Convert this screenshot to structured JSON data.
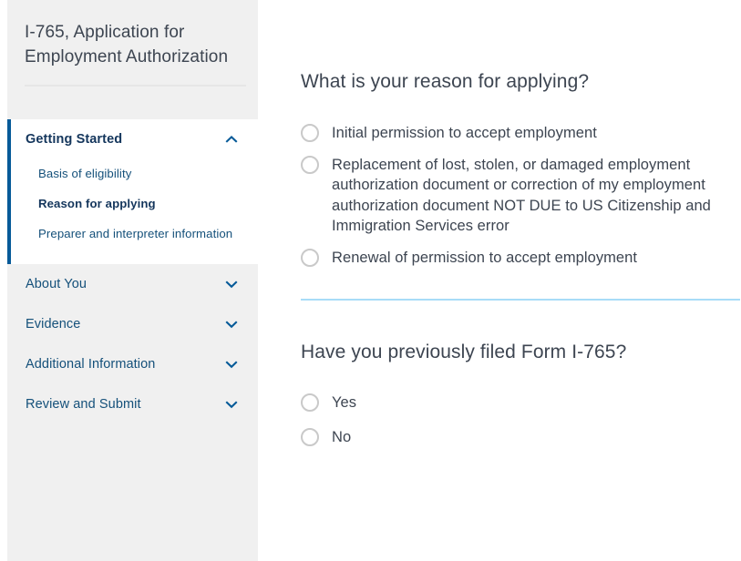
{
  "sidebar": {
    "form_title": "I-765, Application for Employment Authorization",
    "sections": [
      {
        "label": "Getting Started",
        "icon": "chevron-up-icon",
        "expanded": true,
        "subitems": [
          {
            "label": "Basis of eligibility",
            "current": false
          },
          {
            "label": "Reason for applying",
            "current": true
          },
          {
            "label": "Preparer and interpreter information",
            "current": false
          }
        ]
      },
      {
        "label": "About You",
        "icon": "chevron-down-icon",
        "expanded": false,
        "subitems": []
      },
      {
        "label": "Evidence",
        "icon": "chevron-down-icon",
        "expanded": false,
        "subitems": []
      },
      {
        "label": "Additional Information",
        "icon": "chevron-down-icon",
        "expanded": false,
        "subitems": []
      },
      {
        "label": "Review and Submit",
        "icon": "chevron-down-icon",
        "expanded": false,
        "subitems": []
      }
    ]
  },
  "main": {
    "question1": {
      "heading": "What is your reason for applying?",
      "options": [
        {
          "label": "Initial permission to accept employment",
          "selected": false
        },
        {
          "label": "Replacement of lost, stolen, or damaged employment authorization document or correction of my employment authorization document NOT DUE to US Citizenship and Immigration Services error",
          "selected": false
        },
        {
          "label": "Renewal of permission to accept employment",
          "selected": false
        }
      ]
    },
    "question2": {
      "heading": "Have you previously filed Form I-765?",
      "options": [
        {
          "label": "Yes",
          "selected": false
        },
        {
          "label": "No",
          "selected": false
        }
      ]
    }
  },
  "colors": {
    "accent_blue": "#065a98",
    "link_blue": "#14507a",
    "text_gray": "#3d4551",
    "sidebar_bg": "#f0f0f0",
    "divider_blue": "#a8dcf8"
  }
}
